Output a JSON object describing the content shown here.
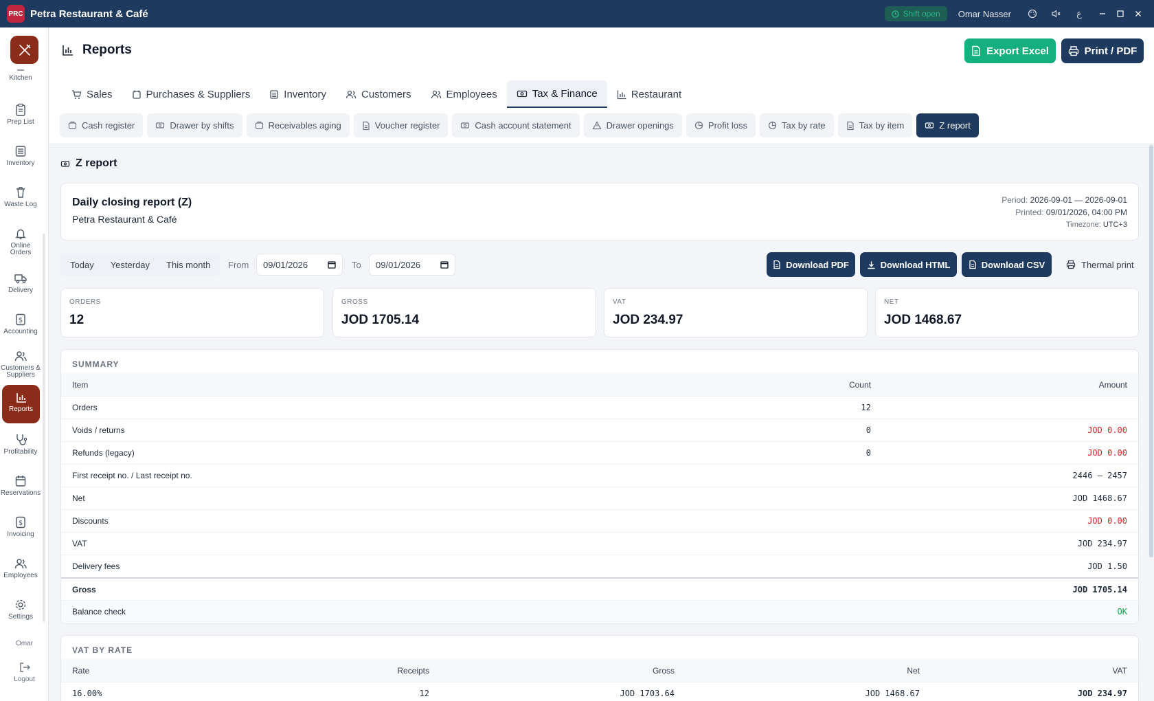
{
  "window": {
    "app_title": "Petra Restaurant & Café",
    "logo_text": "PRC",
    "shift_status": "Shift open",
    "user": "Omar Nasser",
    "lang_toggle": "ع"
  },
  "sidebar": {
    "items": [
      {
        "label": "Kitchen",
        "icon": "kitchen-icon"
      },
      {
        "label": "Prep List",
        "icon": "clipboard-icon"
      },
      {
        "label": "Inventory",
        "icon": "inventory-icon"
      },
      {
        "label": "Waste Log",
        "icon": "trash-icon"
      },
      {
        "label": "Online Orders",
        "icon": "bell-icon"
      },
      {
        "label": "Delivery",
        "icon": "truck-icon"
      },
      {
        "label": "Accounting",
        "icon": "dollar-icon"
      },
      {
        "label": "Customers & Suppliers",
        "icon": "users-icon"
      },
      {
        "label": "Reports",
        "icon": "chart-icon"
      },
      {
        "label": "Profitability",
        "icon": "stethoscope-icon"
      },
      {
        "label": "Reservations",
        "icon": "calendar-icon"
      },
      {
        "label": "Invoicing",
        "icon": "invoice-icon"
      },
      {
        "label": "Employees",
        "icon": "users-icon"
      },
      {
        "label": "Settings",
        "icon": "gear-icon"
      }
    ],
    "footer_user": "Omar",
    "logout": "Logout"
  },
  "header": {
    "title": "Reports",
    "export_excel": "Export Excel",
    "print_pdf": "Print / PDF",
    "tabs": [
      "Sales",
      "Purchases & Suppliers",
      "Inventory",
      "Customers",
      "Employees",
      "Tax & Finance",
      "Restaurant"
    ],
    "active_tab": "Tax & Finance",
    "sub_tabs": [
      "Cash register",
      "Drawer by shifts",
      "Receivables aging",
      "Voucher register",
      "Cash account statement",
      "Drawer openings",
      "Profit loss",
      "Tax by rate",
      "Tax by item",
      "Z report"
    ],
    "active_sub_tab": "Z report"
  },
  "report": {
    "section_title": "Z report",
    "title": "Daily closing report (Z)",
    "business": "Petra Restaurant & Café",
    "period_label": "Period:",
    "period": "2026-09-01 — 2026-09-01",
    "printed_label": "Printed:",
    "printed": "09/01/2026, 04:00 PM",
    "timezone_label": "Timezone:",
    "timezone": "UTC+3"
  },
  "filters": {
    "today": "Today",
    "yesterday": "Yesterday",
    "this_month": "This month",
    "from_label": "From",
    "from": "09/01/2026",
    "to_label": "To",
    "to": "09/01/2026",
    "download_pdf": "Download PDF",
    "download_html": "Download HTML",
    "download_csv": "Download CSV",
    "thermal_print": "Thermal print"
  },
  "kpis": {
    "orders": {
      "label": "ORDERS",
      "value": "12"
    },
    "gross": {
      "label": "GROSS",
      "value": "JOD 1705.14"
    },
    "vat": {
      "label": "VAT",
      "value": "JOD 234.97"
    },
    "net": {
      "label": "NET",
      "value": "JOD 1468.67"
    }
  },
  "summary": {
    "title": "SUMMARY",
    "headers": {
      "item": "Item",
      "count": "Count",
      "amount": "Amount"
    },
    "rows": [
      {
        "item": "Orders",
        "count": "12",
        "amount": ""
      },
      {
        "item": "Voids / returns",
        "count": "0",
        "amount": "JOD 0.00"
      },
      {
        "item": "Refunds (legacy)",
        "count": "0",
        "amount": "JOD 0.00"
      },
      {
        "item": "First receipt no. / Last receipt no.",
        "count": "",
        "amount": "2446 – 2457"
      },
      {
        "item": "Net",
        "count": "",
        "amount": "JOD 1468.67"
      },
      {
        "item": "Discounts",
        "count": "",
        "amount": "JOD 0.00"
      },
      {
        "item": "VAT",
        "count": "",
        "amount": "JOD 234.97"
      },
      {
        "item": "Delivery fees",
        "count": "",
        "amount": "JOD 1.50"
      },
      {
        "item": "Gross",
        "count": "",
        "amount": "JOD 1705.14"
      },
      {
        "item": "Balance check",
        "count": "",
        "amount": "OK"
      }
    ]
  },
  "vat_by_rate": {
    "title": "VAT BY RATE",
    "headers": {
      "rate": "Rate",
      "receipts": "Receipts",
      "gross": "Gross",
      "net": "Net",
      "vat": "VAT"
    },
    "rows": [
      {
        "rate": "16.00%",
        "receipts": "12",
        "gross": "JOD 1703.64",
        "net": "JOD 1468.67",
        "vat": "JOD 234.97"
      }
    ]
  },
  "colors": {
    "navy": "#1e3a5f",
    "brand_red": "#8b2c1b",
    "excel_green": "#14b07e",
    "negative_red": "#dc2626",
    "ok_green": "#16a34a"
  }
}
